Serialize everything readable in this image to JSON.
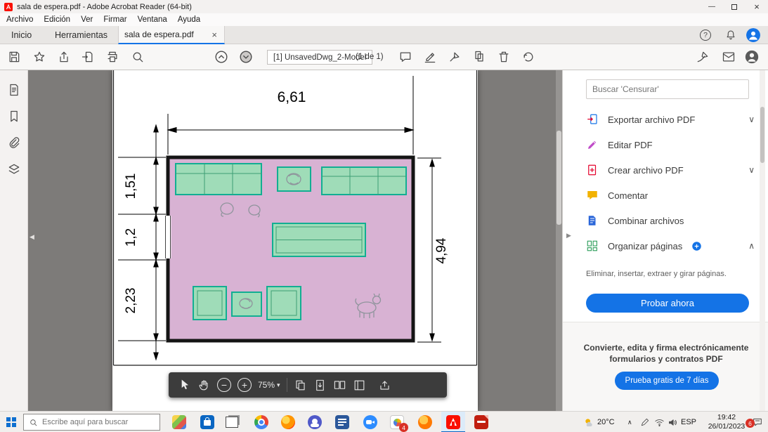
{
  "titlebar": {
    "title": "sala de espera.pdf - Adobe Acrobat Reader (64-bit)"
  },
  "menubar": {
    "items": [
      "Archivo",
      "Edición",
      "Ver",
      "Firmar",
      "Ventana",
      "Ayuda"
    ]
  },
  "tabbar": {
    "home": "Inicio",
    "tools": "Herramientas",
    "doc_tab": "sala de espera.pdf"
  },
  "toolbar": {
    "doc_label": "[1] UnsavedDwg_2-Model",
    "page_indicator": "(1 de 1)"
  },
  "floorplan": {
    "dim_top": "6,61",
    "dim_left_top": "1,51",
    "dim_left_middle": "1,2",
    "dim_left_bottom": "2,23",
    "dim_right": "4,94"
  },
  "zoombar": {
    "zoom_level": "75%"
  },
  "right_panel": {
    "search_placeholder": "Buscar 'Censurar'",
    "tools": [
      {
        "label": "Exportar archivo PDF"
      },
      {
        "label": "Editar PDF"
      },
      {
        "label": "Crear archivo PDF"
      },
      {
        "label": "Comentar"
      },
      {
        "label": "Combinar archivos"
      },
      {
        "label": "Organizar páginas"
      }
    ],
    "organize_description": "Eliminar, insertar, extraer y girar páginas.",
    "try_now_label": "Probar ahora",
    "promo_text": "Convierte, edita y firma electrónicamente formularios y contratos PDF",
    "free_trial_label": "Prueba gratis de 7 días"
  },
  "taskbar": {
    "search_placeholder": "Escribe aquí para buscar",
    "temperature": "20°C",
    "language": "ESP",
    "time": "19:42",
    "date": "26/01/2023",
    "notification_count": "6",
    "app_badge_count": "4"
  },
  "icons": {
    "minimize": "—",
    "close": "×",
    "help": "?",
    "chevron_down": "∨",
    "chevron_up": "∧",
    "dropdown_caret": "▾",
    "pane_left": "◀",
    "pane_right": "▶",
    "zoom_out": "−",
    "zoom_in": "+"
  },
  "colors": {
    "accent_blue": "#1473e6",
    "room_fill": "#d8b2d3",
    "furniture_fill": "#9fdcb8",
    "furniture_stroke": "#12ae92",
    "doc_background": "#7d7b79"
  }
}
